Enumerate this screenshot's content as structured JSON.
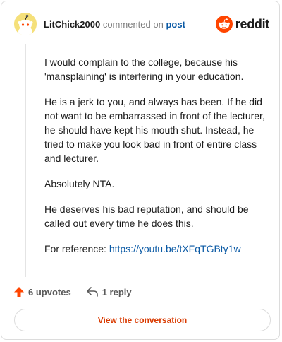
{
  "header": {
    "username": "LitChick2000",
    "action_text": "commented on",
    "post_link": "post",
    "brand": "reddit"
  },
  "comment": {
    "paragraphs": [
      "I would complain to the college, because his 'mansplaining' is interfering in your education.",
      "He is a jerk to you, and always has been. If he did not want to be embarrassed in front of the lecturer, he should have kept his mouth shut. Instead, he tried to make you look bad in front of entire class and lecturer.",
      "Absolutely NTA.",
      "He deserves his bad reputation, and should be called out every time he does this."
    ],
    "reference_prefix": "For reference: ",
    "reference_link": "https://youtu.be/tXFqTGBty1w"
  },
  "actions": {
    "upvotes": "6 upvotes",
    "replies": "1 reply"
  },
  "footer": {
    "view_label": "View the conversation"
  },
  "colors": {
    "upvote": "#ff4500",
    "link": "#0b5aa5",
    "button_text": "#d93a00",
    "avatar_bg": "#f5e07a"
  }
}
